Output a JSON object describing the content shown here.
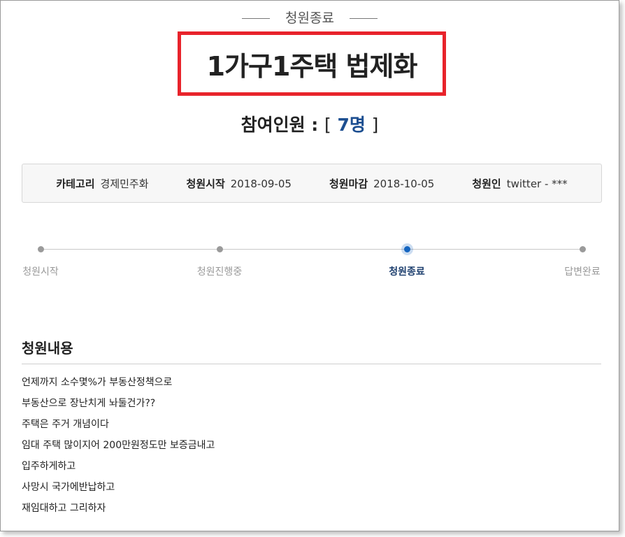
{
  "status_label": "청원종료",
  "petition_title": "1가구1주택 법제화",
  "participants": {
    "label": "참여인원 :",
    "bracket_open": "[",
    "count": "7명",
    "bracket_close": "]"
  },
  "info": {
    "category_label": "카테고리",
    "category_value": "경제민주화",
    "start_label": "청원시작",
    "start_value": "2018-09-05",
    "end_label": "청원마감",
    "end_value": "2018-10-05",
    "author_label": "청원인",
    "author_value": "twitter - ***"
  },
  "progress": {
    "steps": [
      "청원시작",
      "청원진행중",
      "청원종료",
      "답변완료"
    ],
    "active_index": 2
  },
  "section_title": "청원내용",
  "content_lines": [
    "언제까지 소수몇%가 부동산정책으로",
    "부동산으로 장난치게 놔둘건가??",
    "주택은 주거 개념이다",
    "임대 주택 많이지어 200만원정도만 보증금내고",
    "입주하게하고",
    "사망시 국가에반납하고",
    "재임대하고 그리하자"
  ],
  "colors": {
    "title_border": "#e8232b",
    "count": "#1d4f91",
    "active_step": "#1565c0"
  }
}
